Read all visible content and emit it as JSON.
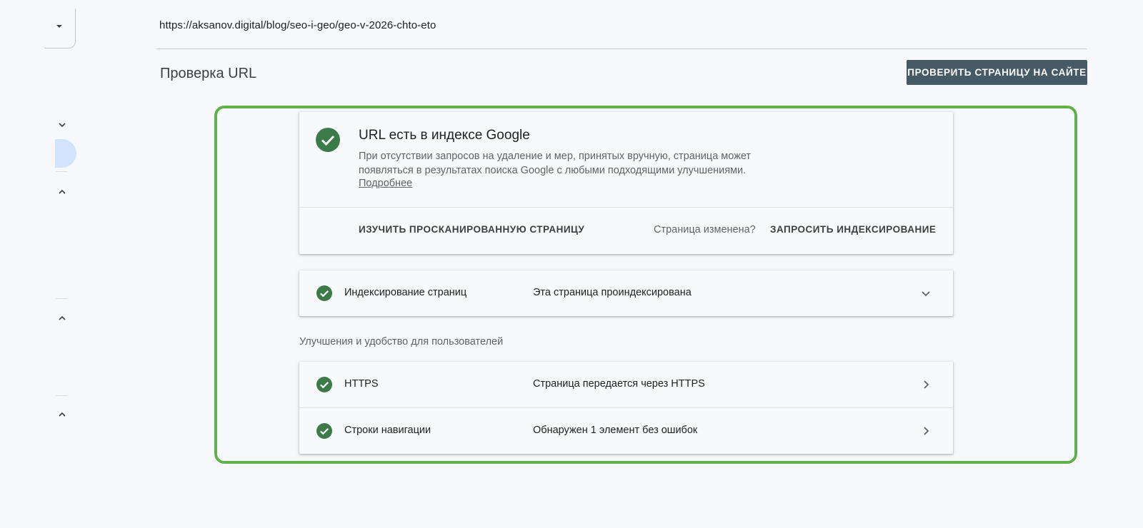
{
  "url": "https://aksanov.digital/blog/seo-i-geo/geo-v-2026-chto-eto",
  "header": {
    "title": "Проверка URL",
    "test_live_button": "ПРОВЕРИТЬ СТРАНИЦУ НА САЙТЕ"
  },
  "status": {
    "headline": "URL есть в индексе Google",
    "description": "При отсутствии запросов на удаление и мер, принятых вручную, страница может появляться в результатах поиска Google с любыми подходящими улучшениями.",
    "learn_more": "Подробнее",
    "view_crawled": "ИЗУЧИТЬ ПРОСКАНИРОВАННУЮ СТРАНИЦУ",
    "page_changed": "Страница изменена?",
    "request_indexing": "ЗАПРОСИТЬ ИНДЕКСИРОВАНИЕ"
  },
  "indexing": {
    "label": "Индексирование страниц",
    "value": "Эта страница проиндексирована"
  },
  "enhancements": {
    "section_title": "Улучшения и удобство для пользователей",
    "items": [
      {
        "label": "HTTPS",
        "value": "Страница передается через HTTPS"
      },
      {
        "label": "Строки навигации",
        "value": "Обнаружен 1 элемент без ошибок"
      }
    ]
  },
  "colors": {
    "success_green": "#34a853",
    "check_dark": "#3c7a4a",
    "highlight_frame": "#62b04a",
    "button_bg": "#455a64"
  },
  "icons": {
    "status": "check-circle-icon",
    "expand": "chevron-down-icon",
    "open": "chevron-right-icon",
    "collapse": "chevron-up-icon"
  }
}
